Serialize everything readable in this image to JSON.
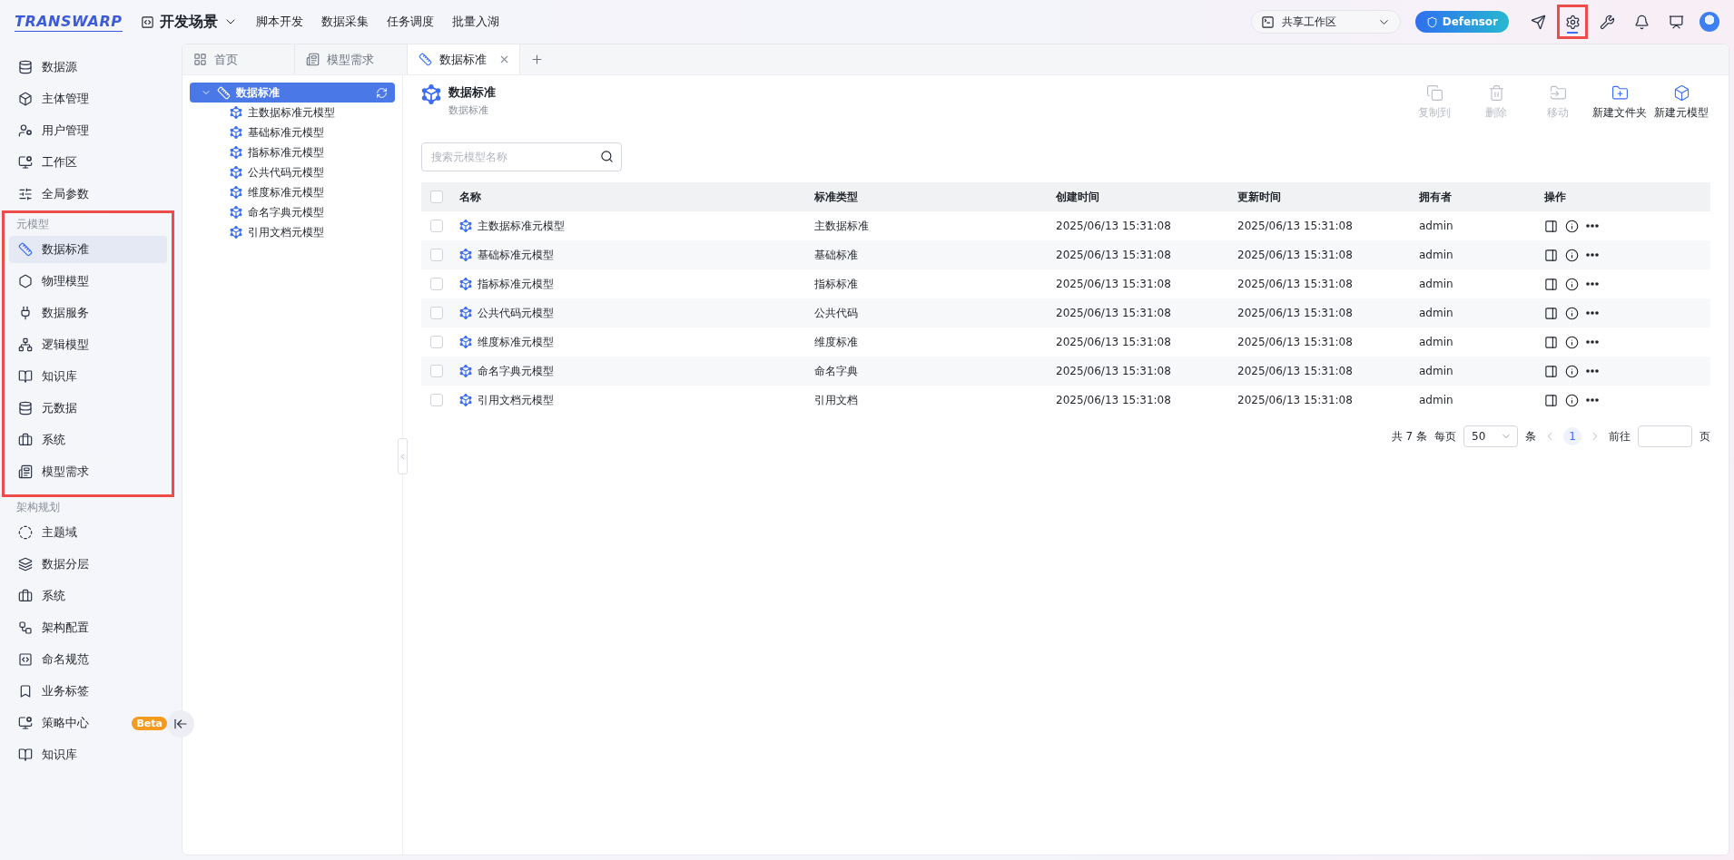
{
  "topbar": {
    "logo": "TRANSWARP",
    "scene": "开发场景",
    "nav": [
      "脚本开发",
      "数据采集",
      "任务调度",
      "批量入湖"
    ],
    "workspace": "共享工作区",
    "defensor": "Defensor",
    "tools": [
      {
        "selected": false,
        "highlighted": false
      },
      {
        "selected": true,
        "highlighted": true
      },
      {
        "selected": false,
        "highlighted": false
      },
      {
        "selected": false,
        "highlighted": false
      },
      {
        "selected": false,
        "highlighted": false
      }
    ]
  },
  "sidebar": {
    "groups": [
      {
        "highlighted": false,
        "items": [
          {
            "label": "数据源",
            "selected": false
          },
          {
            "label": "主体管理",
            "selected": false
          },
          {
            "label": "用户管理",
            "selected": false
          },
          {
            "label": "工作区",
            "selected": false
          },
          {
            "label": "全局参数",
            "selected": false
          }
        ]
      },
      {
        "title": "元模型",
        "highlighted": true,
        "items": [
          {
            "label": "数据标准",
            "selected": true
          },
          {
            "label": "物理模型",
            "selected": false
          },
          {
            "label": "数据服务",
            "selected": false
          },
          {
            "label": "逻辑模型",
            "selected": false
          },
          {
            "label": "知识库",
            "selected": false
          },
          {
            "label": "元数据",
            "selected": false
          },
          {
            "label": "系统",
            "selected": false
          },
          {
            "label": "模型需求",
            "selected": false
          }
        ]
      },
      {
        "title": "架构规划",
        "highlighted": false,
        "items": [
          {
            "label": "主题域",
            "selected": false
          },
          {
            "label": "数据分层",
            "selected": false
          },
          {
            "label": "系统",
            "selected": false
          },
          {
            "label": "架构配置",
            "selected": false
          },
          {
            "label": "命名规范",
            "selected": false
          },
          {
            "label": "业务标签",
            "selected": false
          },
          {
            "label": "策略中心",
            "selected": false,
            "badge": "Beta"
          },
          {
            "label": "知识库",
            "selected": false
          }
        ]
      }
    ]
  },
  "tabs": [
    {
      "label": "首页",
      "selected": false,
      "closable": false
    },
    {
      "label": "模型需求",
      "selected": false,
      "closable": false
    },
    {
      "label": "数据标准",
      "selected": true,
      "closable": true
    }
  ],
  "tree": {
    "label": "数据标准",
    "selected": true,
    "expanded": true,
    "children": [
      {
        "label": "主数据标准元模型"
      },
      {
        "label": "基础标准元模型"
      },
      {
        "label": "指标标准元模型"
      },
      {
        "label": "公共代码元模型"
      },
      {
        "label": "维度标准元模型"
      },
      {
        "label": "命名字典元模型"
      },
      {
        "label": "引用文档元模型"
      }
    ]
  },
  "content": {
    "title": "数据标准",
    "subtitle": "数据标准",
    "actions": [
      {
        "label": "复制到",
        "disabled": true
      },
      {
        "label": "删除",
        "disabled": true
      },
      {
        "label": "移动",
        "disabled": true
      },
      {
        "label": "新建文件夹",
        "disabled": false
      },
      {
        "label": "新建元模型",
        "disabled": false
      }
    ],
    "search": {
      "placeholder": "搜索元模型名称"
    },
    "table": {
      "header_checked": false,
      "columns": [
        "名称",
        "标准类型",
        "创建时间",
        "更新时间",
        "拥有者",
        "操作"
      ],
      "rows": [
        {
          "checked": false,
          "cells": [
            "主数据标准元模型",
            "主数据标准",
            "2025/06/13 15:31:08",
            "2025/06/13 15:31:08",
            "admin"
          ]
        },
        {
          "checked": false,
          "cells": [
            "基础标准元模型",
            "基础标准",
            "2025/06/13 15:31:08",
            "2025/06/13 15:31:08",
            "admin"
          ]
        },
        {
          "checked": false,
          "cells": [
            "指标标准元模型",
            "指标标准",
            "2025/06/13 15:31:08",
            "2025/06/13 15:31:08",
            "admin"
          ]
        },
        {
          "checked": false,
          "cells": [
            "公共代码元模型",
            "公共代码",
            "2025/06/13 15:31:08",
            "2025/06/13 15:31:08",
            "admin"
          ]
        },
        {
          "checked": false,
          "cells": [
            "维度标准元模型",
            "维度标准",
            "2025/06/13 15:31:08",
            "2025/06/13 15:31:08",
            "admin"
          ]
        },
        {
          "checked": false,
          "cells": [
            "命名字典元模型",
            "命名字典",
            "2025/06/13 15:31:08",
            "2025/06/13 15:31:08",
            "admin"
          ]
        },
        {
          "checked": false,
          "cells": [
            "引用文档元模型",
            "引用文档",
            "2025/06/13 15:31:08",
            "2025/06/13 15:31:08",
            "admin"
          ]
        }
      ]
    },
    "pagination": {
      "total": "共 7 条",
      "per_page": "每页",
      "page_size": "50",
      "unit": "条",
      "pages": [
        {
          "label": "1",
          "selected": true
        }
      ],
      "goto": "前往",
      "goto_unit": "页"
    }
  }
}
